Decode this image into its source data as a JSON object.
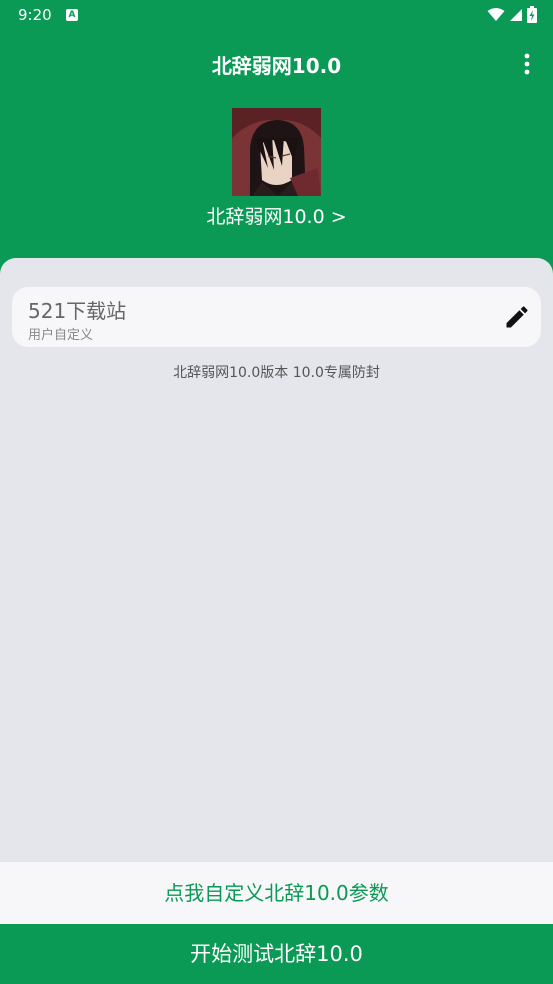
{
  "status_bar": {
    "time": "9:20",
    "notification_icon": "a-notification-icon",
    "wifi_icon": "wifi-icon",
    "signal_icon": "signal-icon",
    "battery_icon": "battery-charging-icon"
  },
  "toolbar": {
    "title": "北辞弱网10.0",
    "menu_icon": "more-vert-icon"
  },
  "profile": {
    "link_text": "北辞弱网10.0 >"
  },
  "config": {
    "name": "521下载站",
    "subtitle": "用户自定义",
    "edit_icon": "edit-icon"
  },
  "version_text": "北辞弱网10.0版本 10.0专属防封",
  "buttons": {
    "customize_label": "点我自定义北辞10.0参数",
    "start_label": "开始测试北辞10.0"
  },
  "colors": {
    "primary": "#0a9a56",
    "background": "#e5e5ec",
    "card": "#f7f7f9"
  }
}
